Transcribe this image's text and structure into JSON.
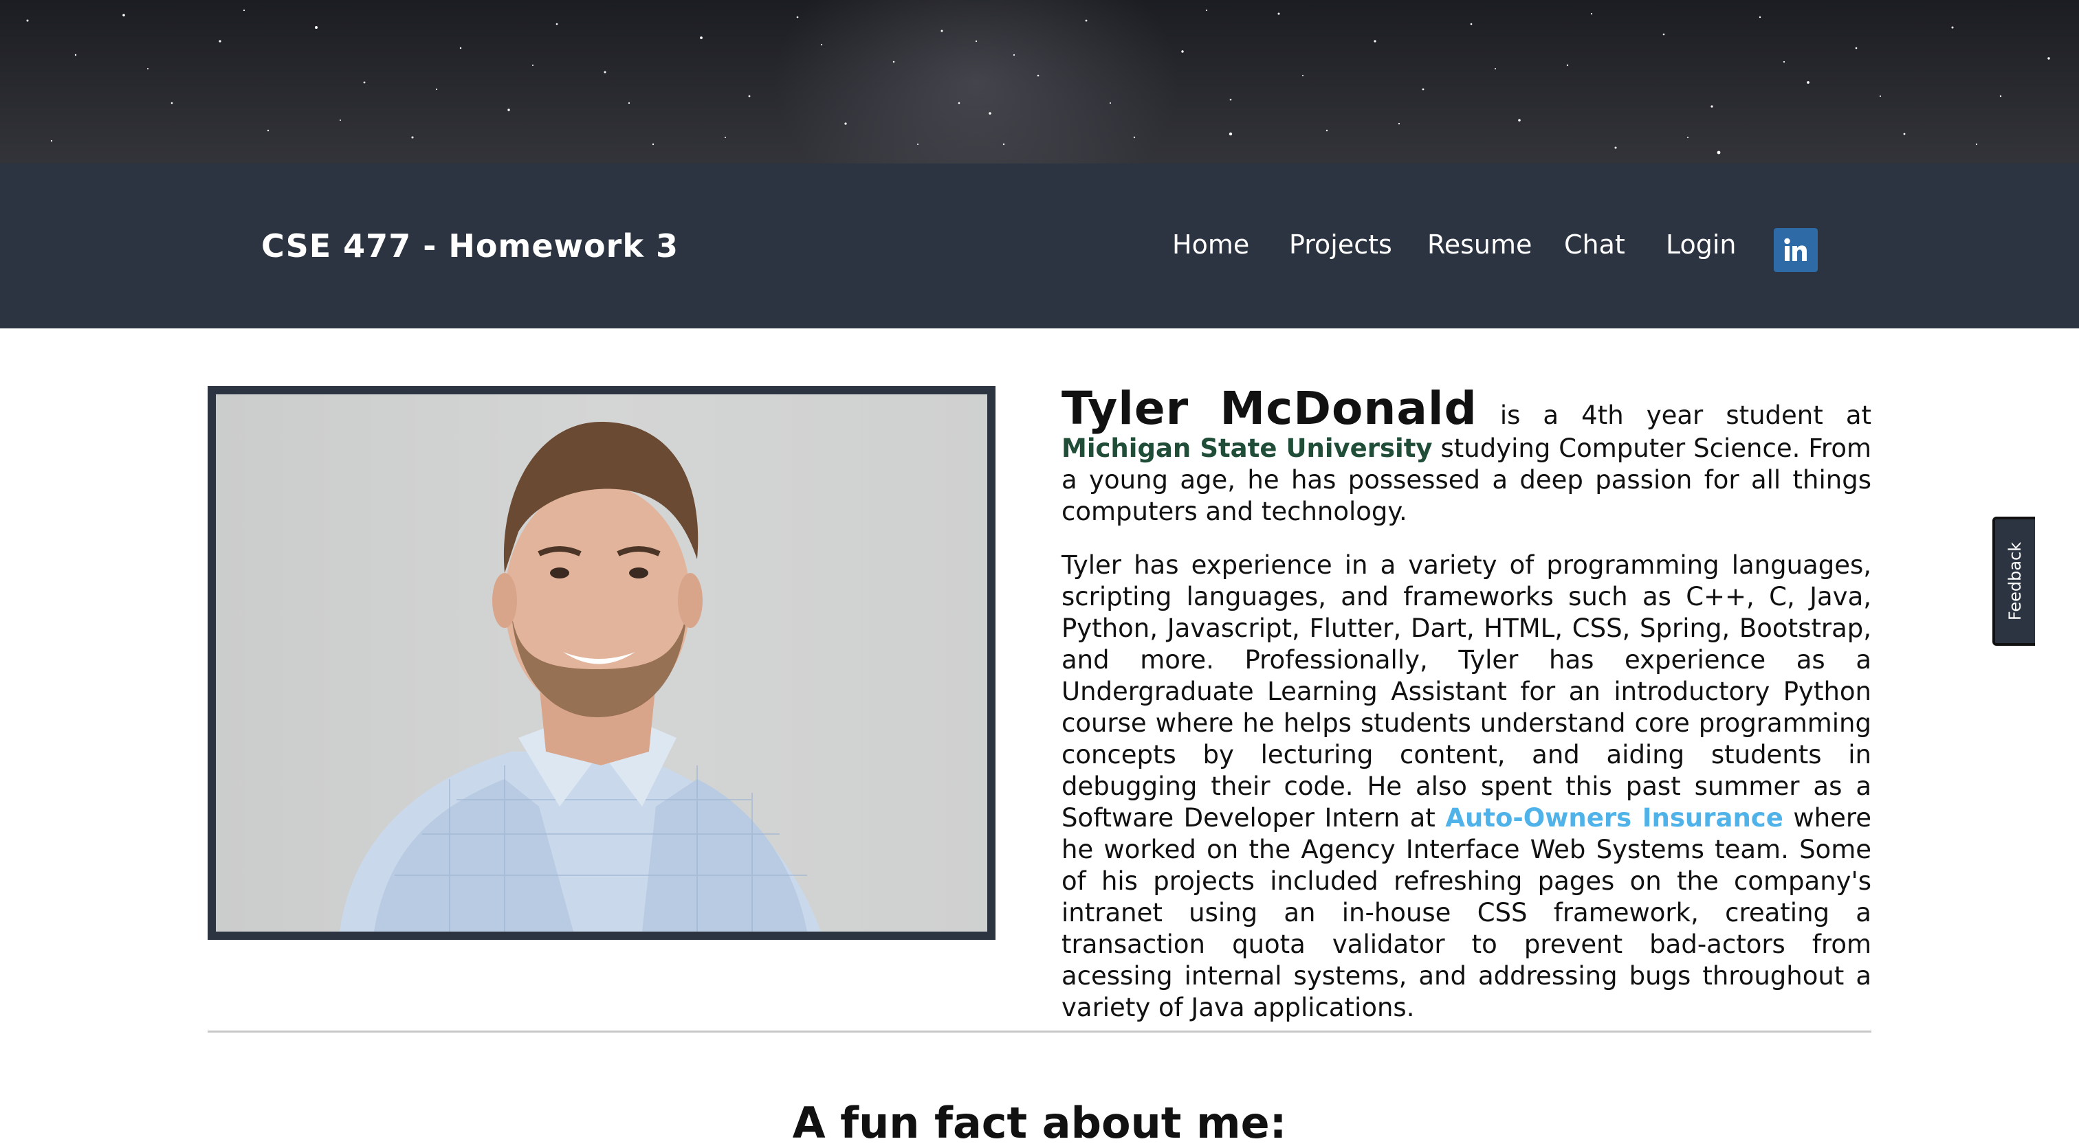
{
  "header": {
    "brand": "CSE 477 - Homework 3",
    "nav": [
      {
        "label": "Home"
      },
      {
        "label": "Projects"
      },
      {
        "label": "Resume"
      },
      {
        "label": "Chat"
      },
      {
        "label": "Login"
      }
    ],
    "social_icon": "linkedin-icon",
    "social_text": "in"
  },
  "profile": {
    "photo_icon": "profile-photo",
    "name": "Tyler McDonald",
    "intro_before": "is a 4th year student at",
    "university": "Michigan State University",
    "intro_after": "studying Computer Science. From a young age, he has possessed a deep passion for all things computers and technology.",
    "experience_before": "Tyler has experience in a variety of programming languages, scripting languages, and frameworks such as C++, C, Java, Python, Javascript, Flutter, Dart, HTML, CSS, Spring, Bootstrap, and more. Professionally, Tyler has experience as a Undergraduate Learning Assistant for an introductory Python course where he helps students understand core programming concepts by lecturing content, and aiding students in debugging their code. He also spent this past summer as a Software Developer Intern at",
    "company": "Auto-Owners Insurance",
    "experience_after": "where he worked on the Agency Interface Web Systems team. Some of his projects included refreshing pages on the company's intranet using an in-house CSS framework, creating a transaction quota validator to prevent bad-actors from acessing internal systems, and addressing bugs throughout a variety of Java applications."
  },
  "fun_fact_heading": "A fun fact about me:",
  "feedback_label": "Feedback",
  "colors": {
    "navbar": "#2c3441",
    "university": "#1f4d37",
    "company": "#4fb3ea",
    "linkedin": "#2e6aa6"
  }
}
